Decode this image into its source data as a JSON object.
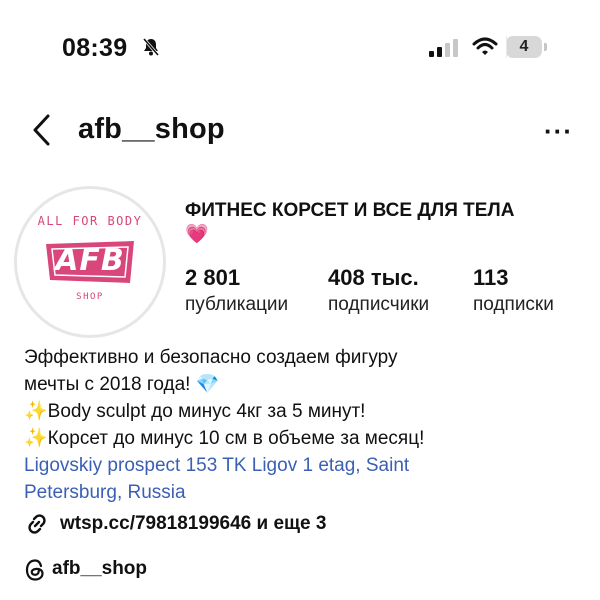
{
  "status_bar": {
    "time": "08:39",
    "battery_percent": "4"
  },
  "header": {
    "username": "afb__shop",
    "more_label": "···"
  },
  "avatar": {
    "logo_top": "ALL FOR BODY",
    "logo_main": "AFB",
    "logo_bottom": "SHOP"
  },
  "profile": {
    "name": "ФИТНЕС КОРСЕТ И ВСЕ ДЛЯ ТЕЛА",
    "name_emoji": "💗"
  },
  "stats": [
    {
      "value": "2 801",
      "label": "публикации"
    },
    {
      "value": "408 тыс.",
      "label": "подписчики"
    },
    {
      "value": "113",
      "label": "подписки"
    }
  ],
  "bio": {
    "line1": "Эффективно и безопасно создаем фигуру",
    "line2": "мечты с 2018 года! 💎",
    "line3": "✨Body sculpt до минус 4кг за 5 минут!",
    "line4": "✨Корсет до минус 10 см в объеме за месяц!",
    "location_line1": "Ligovskiy prospect 153 TK Ligov 1 etag, Saint",
    "location_line2": "Petersburg, Russia"
  },
  "link": {
    "text": "wtsp.cc/79818199646 и еще 3"
  },
  "threads": {
    "handle": "afb__shop"
  },
  "colors": {
    "brand_pink": "#d8467c",
    "link_blue": "#3b5fb5"
  }
}
